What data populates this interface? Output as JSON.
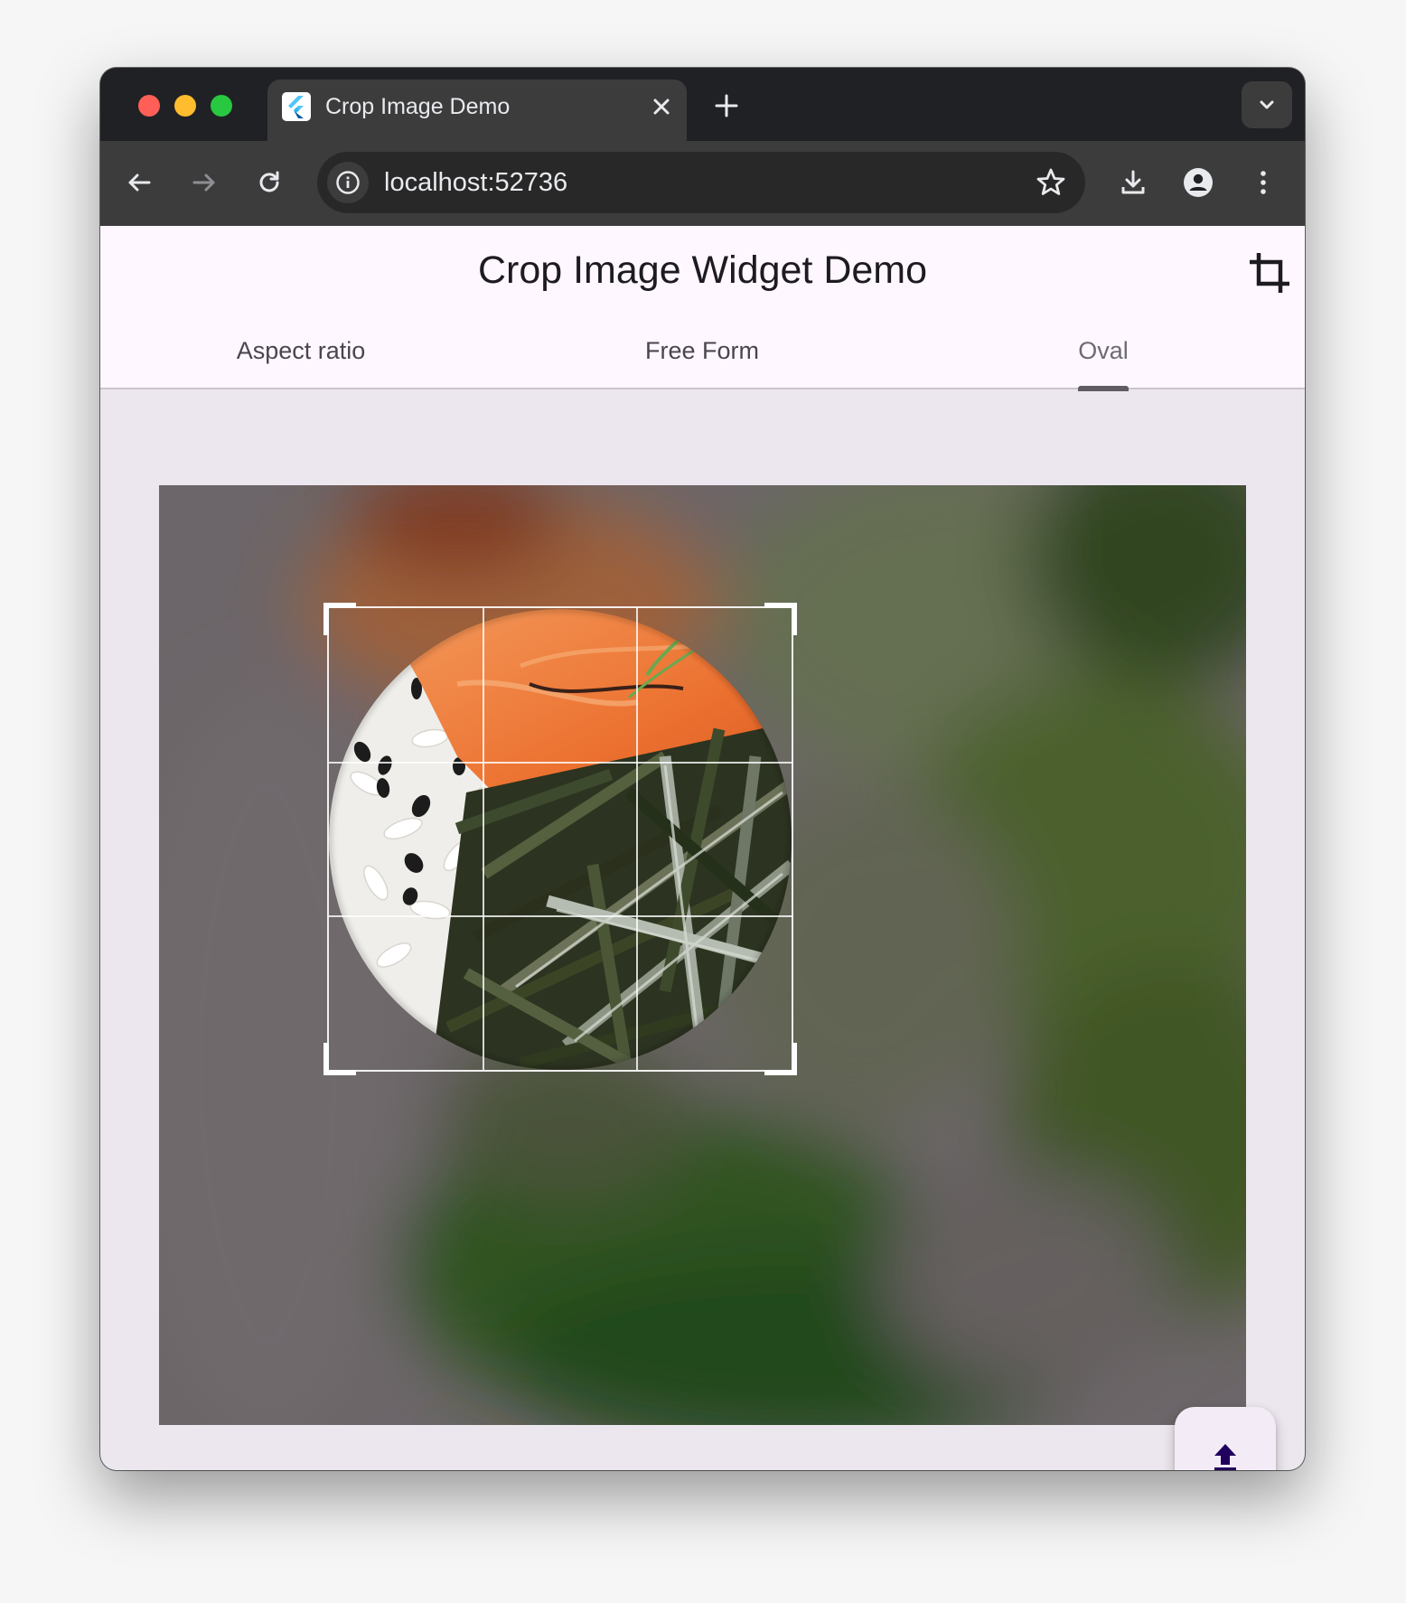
{
  "browser": {
    "tab": {
      "title": "Crop Image Demo",
      "favicon": "flutter-logo-icon",
      "close_icon": "close-icon"
    },
    "new_tab_icon": "plus-icon",
    "tab_search_icon": "chevron-down-icon",
    "nav": {
      "back_icon": "arrow-left-icon",
      "forward_icon": "arrow-right-icon",
      "reload_icon": "reload-icon"
    },
    "omnibox": {
      "url": "localhost:52736",
      "site_info_icon": "info-icon",
      "bookmark_icon": "star-icon"
    },
    "toolbar_icons": [
      "download-icon",
      "profile-icon",
      "more-vert-icon"
    ]
  },
  "app": {
    "title": "Crop Image Widget Demo",
    "action_icon": "crop-icon",
    "tabs": [
      {
        "label": "Aspect ratio",
        "selected": false
      },
      {
        "label": "Free Form",
        "selected": false
      },
      {
        "label": "Oval",
        "selected": true
      }
    ],
    "crop": {
      "shape": "oval",
      "grid": "3x3"
    },
    "fab_icon": "upload-icon"
  },
  "colors": {
    "titlebar": "#202124",
    "toolbar": "#3c3c3d",
    "appbar": "#fef7ff",
    "page_bg": "#ece6ee",
    "tab_indicator": "#5f5c64",
    "fab_bg": "#f3ecf6",
    "fab_icon": "#21005d"
  }
}
